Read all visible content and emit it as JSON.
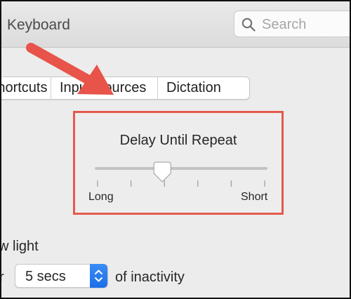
{
  "window": {
    "title": "Keyboard"
  },
  "search": {
    "placeholder": "Search"
  },
  "tabs": [
    {
      "label": "Shortcuts"
    },
    {
      "label": "Input Sources"
    },
    {
      "label": "Dictation"
    }
  ],
  "delay_slider": {
    "title": "Delay Until Repeat",
    "min_label": "Long",
    "max_label": "Short",
    "tick_count": 6,
    "selected_tick": 2
  },
  "backlight": {
    "label_fragment": "w light"
  },
  "inactivity": {
    "prefix": "r",
    "selected_option": "5 secs",
    "suffix": "of inactivity"
  },
  "colors": {
    "highlight": "#e45a4d",
    "accent": "#1b6ee8"
  }
}
